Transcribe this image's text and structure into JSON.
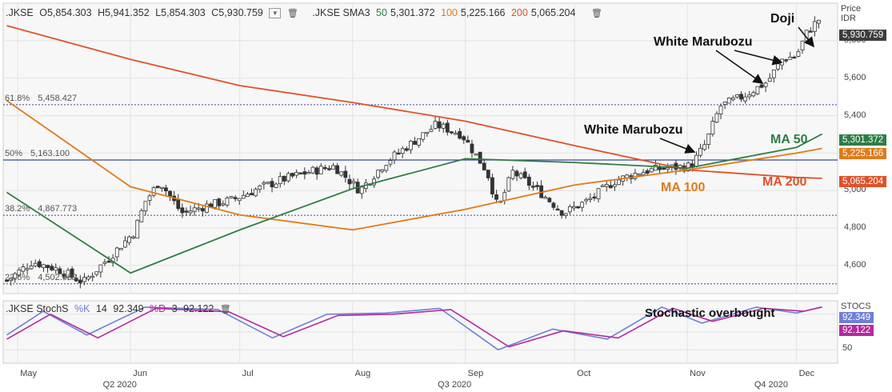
{
  "header": {
    "symbol": ".JKSE",
    "open_label": "O",
    "open": "5,854.303",
    "high_label": "H",
    "high": "5,941.352",
    "low_label": "L",
    "low": "5,854.303",
    "close_label": "C",
    "close": "5,930.759",
    "sma_label": ".JKSE SMA3",
    "sma50_period": "50",
    "sma50_value": "5,301.372",
    "sma100_period": "100",
    "sma100_value": "5,225.166",
    "sma200_period": "200",
    "sma200_value": "5,065.204"
  },
  "stoch_header": {
    "label": ".JKSE StochS",
    "k_label": "%K",
    "k_period": "14",
    "k_value": "92.349",
    "d_label": "%D",
    "d_period": "3",
    "d_value": "92.122"
  },
  "axis": {
    "price_title_1": "Price",
    "price_title_2": "IDR",
    "stoch_title": "STOCS",
    "y_ticks": [
      "5,800",
      "5,600",
      "5,400",
      "5,200",
      "5,000",
      "4,800",
      "4,600"
    ],
    "stoch_tick": "50",
    "months": [
      "May",
      "Jun",
      "Jul",
      "Aug",
      "Sep",
      "Oct",
      "Nov",
      "Dec"
    ],
    "quarters": [
      "Q2 2020",
      "Q3 2020",
      "Q4 2020"
    ]
  },
  "tags": {
    "close": "5,930.759",
    "ma50": "5,301.372",
    "ma100": "5,225.166",
    "ma200": "5,065.204",
    "k": "92.349",
    "d": "92.122"
  },
  "fib": [
    {
      "label": "61.8%",
      "value": "5,458.427"
    },
    {
      "label": "50%",
      "value": "5,163.100"
    },
    {
      "label": "38.2%",
      "value": "4,867.773"
    },
    {
      "label": "23.6%",
      "value": "4,502.469"
    }
  ],
  "annotations": {
    "doji": "Doji",
    "white_marubozu_top": "White Marubozu",
    "white_marubozu_mid": "White Marubozu",
    "ma50": "MA 50",
    "ma100": "MA 100",
    "ma200": "MA 200",
    "stoch": "Stochastic overbought"
  },
  "colors": {
    "ma50": "#2e7d46",
    "ma100": "#e07b1a",
    "ma200": "#e0522a",
    "k": "#6f7fd6",
    "d": "#b5299e",
    "fib": "#3a4a9a",
    "candle": "#333333",
    "close_tag": "#3d3d3d",
    "k_tag": "#6f7fd6",
    "d_tag": "#b5299e"
  },
  "chart_data": {
    "type": "candlestick",
    "title": "",
    "x": [
      "2020-05",
      "2020-06",
      "2020-07",
      "2020-08",
      "2020-09",
      "2020-10",
      "2020-11",
      "2020-12"
    ],
    "ylim": [
      4450,
      6000
    ],
    "price_path": [
      [
        "2020-04-28",
        4520
      ],
      [
        "2020-05-05",
        4620
      ],
      [
        "2020-05-12",
        4580
      ],
      [
        "2020-05-19",
        4510
      ],
      [
        "2020-05-26",
        4640
      ],
      [
        "2020-06-02",
        4780
      ],
      [
        "2020-06-05",
        4940
      ],
      [
        "2020-06-09",
        5050
      ],
      [
        "2020-06-15",
        4880
      ],
      [
        "2020-06-22",
        4920
      ],
      [
        "2020-06-29",
        4950
      ],
      [
        "2020-07-06",
        5010
      ],
      [
        "2020-07-13",
        5060
      ],
      [
        "2020-07-20",
        5100
      ],
      [
        "2020-07-27",
        5130
      ],
      [
        "2020-08-03",
        5000
      ],
      [
        "2020-08-10",
        5150
      ],
      [
        "2020-08-17",
        5250
      ],
      [
        "2020-08-24",
        5350
      ],
      [
        "2020-08-31",
        5300
      ],
      [
        "2020-09-07",
        5100
      ],
      [
        "2020-09-10",
        4900
      ],
      [
        "2020-09-14",
        5100
      ],
      [
        "2020-09-21",
        5000
      ],
      [
        "2020-09-28",
        4880
      ],
      [
        "2020-10-05",
        4950
      ],
      [
        "2020-10-12",
        5050
      ],
      [
        "2020-10-19",
        5100
      ],
      [
        "2020-10-26",
        5120
      ],
      [
        "2020-11-02",
        5130
      ],
      [
        "2020-11-06",
        5250
      ],
      [
        "2020-11-10",
        5450
      ],
      [
        "2020-11-16",
        5500
      ],
      [
        "2020-11-23",
        5580
      ],
      [
        "2020-11-27",
        5700
      ],
      [
        "2020-12-01",
        5720
      ],
      [
        "2020-12-04",
        5850
      ],
      [
        "2020-12-08",
        5930
      ]
    ],
    "sma50": [
      [
        "2020-04-28",
        4990
      ],
      [
        "2020-06-01",
        4560
      ],
      [
        "2020-07-01",
        4790
      ],
      [
        "2020-08-01",
        5010
      ],
      [
        "2020-09-01",
        5170
      ],
      [
        "2020-10-01",
        5150
      ],
      [
        "2020-11-01",
        5120
      ],
      [
        "2020-12-01",
        5230
      ],
      [
        "2020-12-08",
        5301.372
      ]
    ],
    "sma100": [
      [
        "2020-04-28",
        5480
      ],
      [
        "2020-06-01",
        5020
      ],
      [
        "2020-07-01",
        4870
      ],
      [
        "2020-08-01",
        4790
      ],
      [
        "2020-09-01",
        4900
      ],
      [
        "2020-10-01",
        5030
      ],
      [
        "2020-11-01",
        5110
      ],
      [
        "2020-12-01",
        5200
      ],
      [
        "2020-12-08",
        5225.166
      ]
    ],
    "sma200": [
      [
        "2020-04-28",
        5880
      ],
      [
        "2020-06-01",
        5700
      ],
      [
        "2020-07-01",
        5560
      ],
      [
        "2020-08-01",
        5470
      ],
      [
        "2020-09-01",
        5370
      ],
      [
        "2020-10-01",
        5240
      ],
      [
        "2020-11-01",
        5110
      ],
      [
        "2020-12-01",
        5070
      ],
      [
        "2020-12-08",
        5065.204
      ]
    ],
    "fib_levels": [
      5458.427,
      5163.1,
      4867.773,
      4502.469
    ],
    "stoch_k": [
      [
        "2020-04-28",
        45
      ],
      [
        "2020-05-08",
        85
      ],
      [
        "2020-05-20",
        45
      ],
      [
        "2020-06-05",
        92
      ],
      [
        "2020-06-25",
        88
      ],
      [
        "2020-07-10",
        40
      ],
      [
        "2020-07-25",
        80
      ],
      [
        "2020-08-10",
        82
      ],
      [
        "2020-08-25",
        90
      ],
      [
        "2020-09-10",
        20
      ],
      [
        "2020-09-25",
        55
      ],
      [
        "2020-10-10",
        38
      ],
      [
        "2020-10-25",
        92
      ],
      [
        "2020-11-05",
        65
      ],
      [
        "2020-11-20",
        92
      ],
      [
        "2020-12-01",
        82
      ],
      [
        "2020-12-08",
        92.349
      ]
    ],
    "stoch_d": [
      [
        "2020-04-28",
        38
      ],
      [
        "2020-05-10",
        80
      ],
      [
        "2020-05-23",
        40
      ],
      [
        "2020-06-08",
        90
      ],
      [
        "2020-06-28",
        84
      ],
      [
        "2020-07-13",
        42
      ],
      [
        "2020-07-28",
        78
      ],
      [
        "2020-08-12",
        80
      ],
      [
        "2020-08-28",
        88
      ],
      [
        "2020-09-13",
        25
      ],
      [
        "2020-09-28",
        52
      ],
      [
        "2020-10-13",
        40
      ],
      [
        "2020-10-28",
        90
      ],
      [
        "2020-11-08",
        68
      ],
      [
        "2020-11-22",
        90
      ],
      [
        "2020-12-03",
        85
      ],
      [
        "2020-12-08",
        92.122
      ]
    ]
  }
}
